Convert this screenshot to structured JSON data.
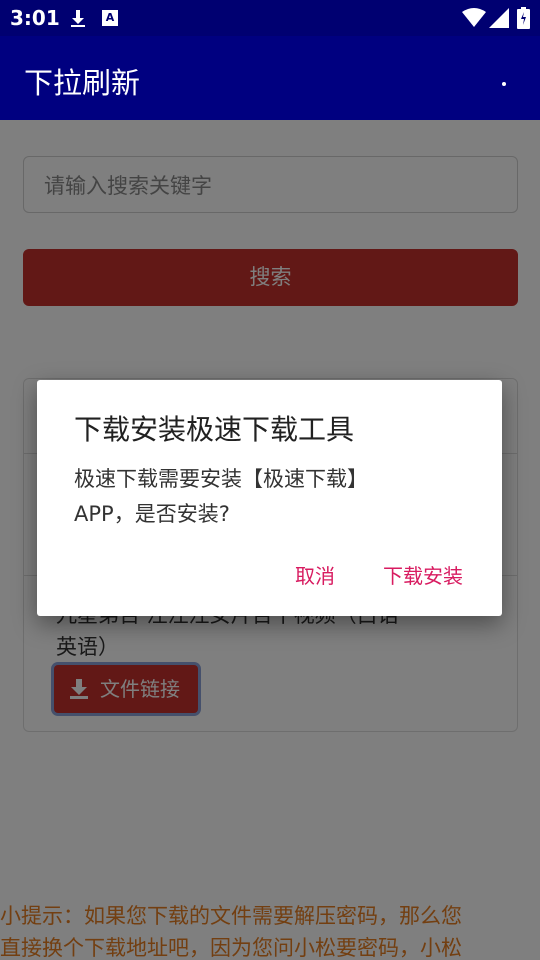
{
  "status_bar": {
    "time": "3:01",
    "a_label": "A",
    "icons": [
      "download-icon",
      "a-notification-icon",
      "wifi-icon",
      "signal-icon",
      "battery-icon"
    ]
  },
  "app_bar": {
    "title": "下拉刷新"
  },
  "search": {
    "placeholder": "请输入搜索关键字",
    "button_label": "搜索"
  },
  "card": {
    "item_title_line1": "九星弟百 注注汪女片百十视频（白话",
    "item_title_line2": "英语）",
    "file_link_label": "文件链接"
  },
  "tip": {
    "line1": "小提示：如果您下载的文件需要解压密码，那么您",
    "line2": "直接换个下载地址吧，因为您问小松要密码，小松"
  },
  "dialog": {
    "title": "下载安装极速下载工具",
    "message_line1": "极速下载需要安装【极速下载】",
    "message_line2": "APP，是否安装?",
    "cancel_label": "取消",
    "confirm_label": "下载安装"
  },
  "colors": {
    "status_bar": "#000071",
    "app_bar": "#000080",
    "accent_red": "#c5312d",
    "dialog_button": "#d81b60",
    "tip_text": "#e67e22"
  }
}
